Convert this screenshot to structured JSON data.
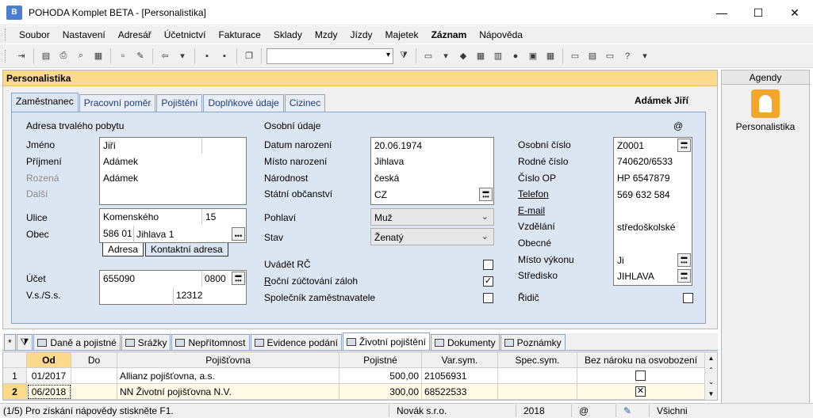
{
  "window": {
    "title": "POHODA Komplet BETA - [Personalistika]",
    "icon": "B"
  },
  "menu": [
    "Soubor",
    "Nastavení",
    "Adresář",
    "Účetnictví",
    "Fakturace",
    "Sklady",
    "Mzdy",
    "Jízdy",
    "Majetek",
    "Záznam",
    "Nápověda"
  ],
  "panel": {
    "title": "Personalistika",
    "person_name": "Adámek Jiří"
  },
  "tabs": [
    "Zaměstnanec",
    "Pracovní poměr",
    "Pojištění",
    "Doplňkové údaje",
    "Cizinec"
  ],
  "address": {
    "section": "Adresa trvalého pobytu",
    "labels": {
      "jmeno": "Jméno",
      "prijmeni": "Příjmení",
      "rozena": "Rozená",
      "dalsi": "Další",
      "ulice": "Ulice",
      "obec": "Obec",
      "ucet": "Účet",
      "vs": "V.s./S.s."
    },
    "jmeno": "Jiří",
    "prijmeni": "Adámek",
    "rozena": "Adámek",
    "ulice": "Komenského",
    "cislo": "15",
    "psc": "586 01",
    "obec": "Jihlava 1",
    "mini_tabs": [
      "Adresa",
      "Kontaktní adresa"
    ],
    "ucet": "655090",
    "kod_banky": "0800",
    "ss": "12312"
  },
  "personal": {
    "section": "Osobní údaje",
    "at_sign": "@",
    "labels": {
      "datum": "Datum narození",
      "misto": "Místo narození",
      "narodnost": "Národnost",
      "obcanstvi": "Státní občanství",
      "pohlavi": "Pohlaví",
      "stav": "Stav",
      "uvadet_rc": "Uvádět RČ",
      "rocni": "Roční zúčtování záloh",
      "spolecnik": "Společník zaměstnavatele"
    },
    "datum": "20.06.1974",
    "misto": "Jihlava",
    "narodnost": "česká",
    "obcanstvi": "CZ",
    "pohlavi": "Muž",
    "stav": "Ženatý",
    "check_mark": "✓"
  },
  "ids": {
    "labels": {
      "osobni": "Osobní číslo",
      "rodne": "Rodné číslo",
      "op": "Číslo OP",
      "telefon": "Telefon",
      "email": "E-mail",
      "vzdelani": "Vzdělání",
      "obecne": "Obecné",
      "misto_vykonu": "Místo výkonu",
      "stredisko": "Středisko",
      "ridic": "Řidič"
    },
    "osobni": "Z0001",
    "rodne": "740620/6533",
    "op": "HP 6547879",
    "telefon": "569 632 584",
    "vzdelani": "středoškolské",
    "misto_vykonu": "Ji",
    "stredisko": "JIHLAVA"
  },
  "agendy": {
    "title": "Agendy",
    "item": "Personalistika"
  },
  "bottom_tabs": [
    "*",
    "Daně a pojistné",
    "Srážky",
    "Nepřítomnost",
    "Evidence podání",
    "Životní pojištění",
    "Dokumenty",
    "Poznámky"
  ],
  "grid": {
    "headers": [
      "Od",
      "Do",
      "Pojišťovna",
      "Pojistné",
      "Var.sym.",
      "Spec.sym.",
      "Bez nároku na osvobození"
    ],
    "rows": [
      {
        "num": "1",
        "od": "01/2017",
        "do": "",
        "pojistovna": "Allianz pojišťovna, a.s.",
        "pojistne": "500,00",
        "vs": "21056931",
        "ss": "",
        "bez": ""
      },
      {
        "num": "2",
        "od": "06/2018",
        "do": "",
        "pojistovna": "NN Životní pojišťovna N.V.",
        "pojistne": "300,00",
        "vs": "68522533",
        "ss": "",
        "bez": "✕"
      }
    ]
  },
  "status": {
    "help": "(1/5) Pro získání nápovědy stiskněte F1.",
    "company": "Novák s.r.o.",
    "year": "2018",
    "at": "@",
    "filter": "Všichni"
  }
}
